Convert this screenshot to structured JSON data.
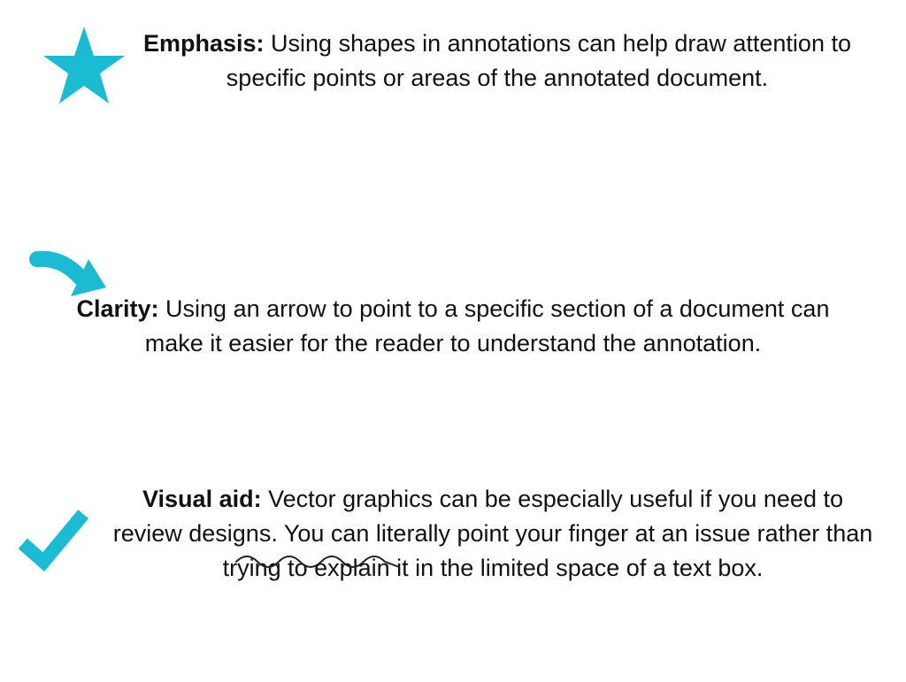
{
  "colors": {
    "accent": "#1CBBD4",
    "text": "#111111",
    "squiggle": "#222222"
  },
  "items": [
    {
      "icon": "star-icon",
      "title": "Emphasis:",
      "body": "Using shapes in annotations can help draw attention to specific points or areas of the annotated document."
    },
    {
      "icon": "arrow-icon",
      "title": "Clarity:",
      "body": "Using an arrow to point to a specific section of a document can make it easier for the reader to understand the annotation."
    },
    {
      "icon": "checkmark-icon",
      "title": "Visual aid:",
      "body": "Vector graphics can be especially useful if you need to review designs. You can literally point your finger at an issue rather than trying to explain it in the limited space of a text box."
    }
  ]
}
